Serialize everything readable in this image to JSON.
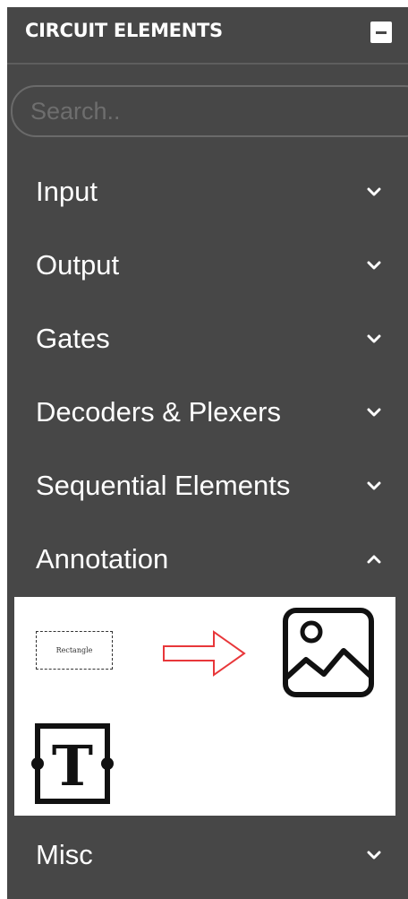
{
  "panel": {
    "title": "CIRCUIT ELEMENTS",
    "minimize_icon": "minus-square-icon"
  },
  "search": {
    "placeholder": "Search..",
    "value": ""
  },
  "categories": [
    {
      "label": "Input",
      "expanded": false
    },
    {
      "label": "Output",
      "expanded": false
    },
    {
      "label": "Gates",
      "expanded": false
    },
    {
      "label": "Decoders & Plexers",
      "expanded": false
    },
    {
      "label": "Sequential Elements",
      "expanded": false
    },
    {
      "label": "Annotation",
      "expanded": true
    },
    {
      "label": "Misc",
      "expanded": false
    }
  ],
  "annotation_items": {
    "rectangle_label": "Rectangle",
    "icons": [
      "rectangle-icon",
      "arrow-icon",
      "image-icon",
      "text-icon"
    ],
    "text_glyph": "T"
  },
  "colors": {
    "panel_bg": "#474747",
    "text": "#ffffff",
    "arrow": "#e8373a"
  }
}
